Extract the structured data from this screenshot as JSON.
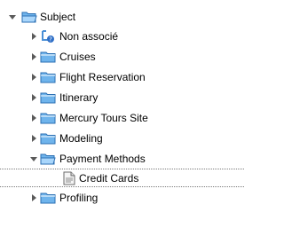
{
  "tree": {
    "root": {
      "label": "Subject",
      "expanded": true,
      "icon": "folder-open-icon"
    },
    "items": [
      {
        "label": "Non associé",
        "icon": "unassigned-folder-icon",
        "toggle": "collapsed"
      },
      {
        "label": "Cruises",
        "icon": "folder-icon",
        "toggle": "collapsed"
      },
      {
        "label": "Flight Reservation",
        "icon": "folder-icon",
        "toggle": "collapsed"
      },
      {
        "label": "Itinerary",
        "icon": "folder-icon",
        "toggle": "collapsed"
      },
      {
        "label": "Mercury Tours Site",
        "icon": "folder-icon",
        "toggle": "collapsed"
      },
      {
        "label": "Modeling",
        "icon": "folder-icon",
        "toggle": "collapsed"
      },
      {
        "label": "Payment Methods",
        "icon": "folder-open-icon",
        "toggle": "expanded",
        "children": [
          {
            "label": "Credit Cards",
            "icon": "document-icon",
            "selected": true
          }
        ]
      },
      {
        "label": "Profiling",
        "icon": "folder-icon",
        "toggle": "collapsed"
      }
    ]
  },
  "colors": {
    "folder_fill": "#6fb4ec",
    "folder_edge": "#2b6fb3",
    "toggle_arrow": "#5a5a5a",
    "selection_border": "#7a7a7a"
  }
}
